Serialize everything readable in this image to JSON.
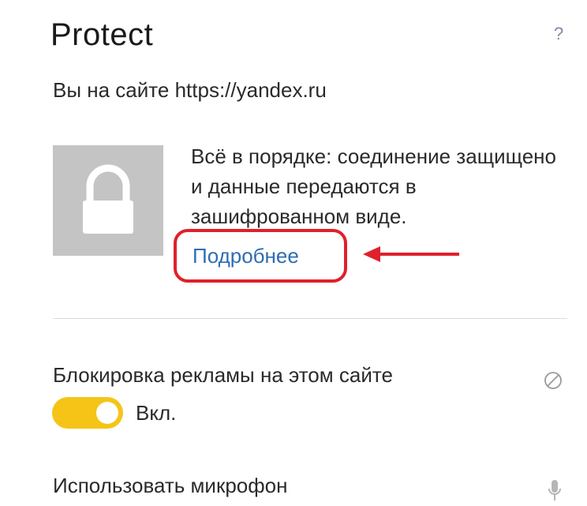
{
  "header": {
    "title": "Protect",
    "help_label": "?"
  },
  "site": {
    "line": "Вы на сайте https://yandex.ru"
  },
  "connection": {
    "status_text": "Всё в порядке: соединение защищено и данные передаются в зашифрованном виде.",
    "more_link": "Подробнее"
  },
  "ads": {
    "label": "Блокировка рекламы на этом сайте",
    "toggle_state": "on",
    "toggle_label": "Вкл."
  },
  "microphone": {
    "label": "Использовать микрофон"
  },
  "colors": {
    "toggle_on": "#f5c417",
    "link": "#2f6db0",
    "annotation_red": "#e0202a",
    "lock_bg": "#c4c4c4"
  },
  "icons": {
    "lock": "lock-icon",
    "block": "block-icon",
    "mic": "microphone-icon",
    "help": "help-icon"
  }
}
